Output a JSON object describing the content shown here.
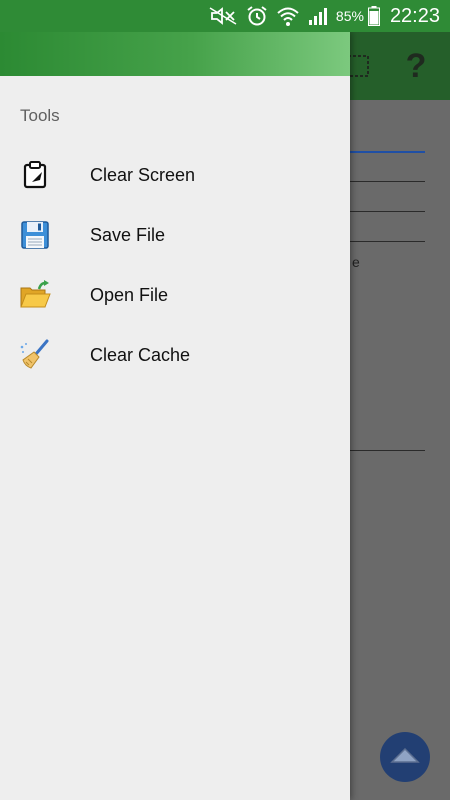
{
  "status_bar": {
    "battery_percent": "85%",
    "time": "22:23",
    "icons": [
      "mute-icon",
      "alarm-icon",
      "wifi-icon",
      "signal-icon",
      "battery-icon"
    ]
  },
  "app": {
    "toolbar_color": "#2e7d32",
    "help_label": "?",
    "partial_text": "e"
  },
  "drawer": {
    "header_color": "#43a047",
    "section_title": "Tools",
    "items": [
      {
        "label": "Clear Screen",
        "icon": "clipboard-icon"
      },
      {
        "label": "Save File",
        "icon": "floppy-disk-icon"
      },
      {
        "label": "Open File",
        "icon": "open-folder-icon"
      },
      {
        "label": "Clear Cache",
        "icon": "broom-icon"
      }
    ]
  }
}
